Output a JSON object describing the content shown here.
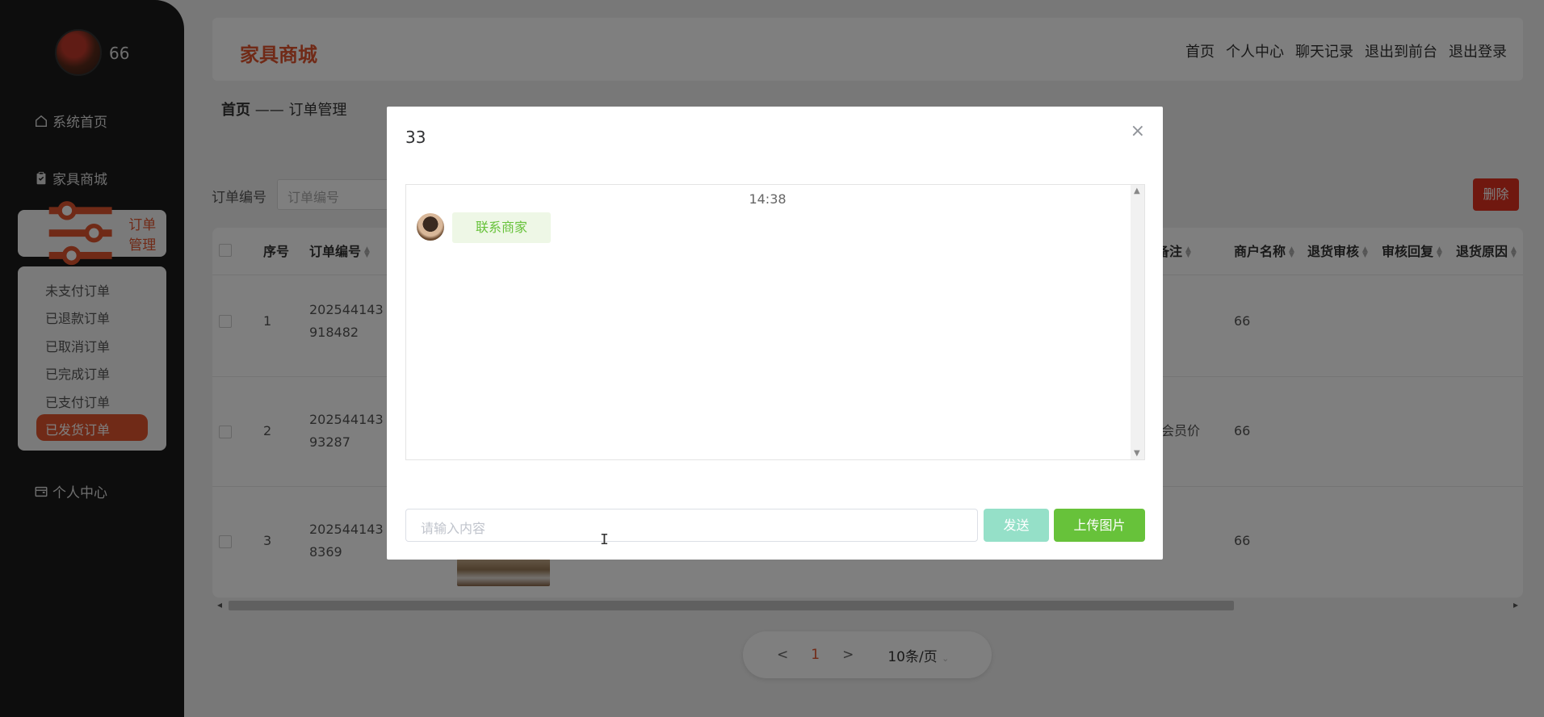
{
  "sidebar": {
    "username": "66",
    "items": [
      {
        "label": "系统首页",
        "icon": "home-icon"
      },
      {
        "label": "家具商城",
        "icon": "clipboard-icon"
      },
      {
        "label": "订单管理",
        "icon": "sliders-icon"
      },
      {
        "label": "个人中心",
        "icon": "wallet-icon"
      }
    ],
    "sub_items": [
      "未支付订单",
      "已退款订单",
      "已取消订单",
      "已完成订单",
      "已支付订单",
      "已发货订单"
    ]
  },
  "header": {
    "brand": "家具商城",
    "nav": [
      "首页",
      "个人中心",
      "聊天记录",
      "退出到前台",
      "退出登录"
    ]
  },
  "breadcrumb": {
    "home": "首页",
    "sep": "——",
    "current": "订单管理"
  },
  "search": {
    "label": "订单编号",
    "placeholder": "订单编号"
  },
  "delete_label": "删除",
  "table": {
    "headers": [
      "序号",
      "订单编号",
      "备注",
      "商户名称",
      "退货审核",
      "审核回复",
      "退货原因"
    ],
    "rows": [
      {
        "index": "1",
        "order_no_1": "202544143",
        "order_no_2": "918482",
        "remark": "",
        "merchant": "66"
      },
      {
        "index": "2",
        "order_no_1": "202544143",
        "order_no_2": "93287",
        "remark": "会员价",
        "merchant": "66"
      },
      {
        "index": "3",
        "order_no_1": "202544143",
        "order_no_2": "8369",
        "remark": "",
        "merchant": "66"
      }
    ]
  },
  "pagination": {
    "prev": "<",
    "current": "1",
    "next": ">",
    "size": "10条/页"
  },
  "modal": {
    "title": "33",
    "close": "×",
    "time": "14:38",
    "message": "联系商家",
    "input_placeholder": "请输入内容",
    "send": "发送",
    "upload": "上传图片"
  },
  "colors": {
    "accent": "#e0552f",
    "green": "#67c23a",
    "danger": "#e0301e"
  }
}
